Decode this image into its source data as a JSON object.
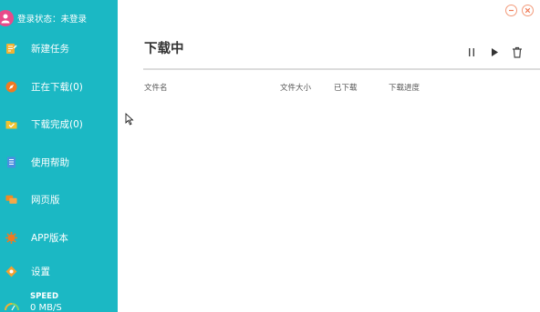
{
  "sidebar": {
    "login_status": "登录状态：未登录",
    "items": [
      {
        "label": "新建任务",
        "icon": "new-task-icon",
        "color": "#f2b233"
      },
      {
        "label": "正在下载(0)",
        "icon": "compass-icon",
        "color": "#f07a22"
      },
      {
        "label": "下载完成(0)",
        "icon": "folder-check-icon",
        "color": "#f2c230"
      },
      {
        "label": "使用帮助",
        "icon": "help-book-icon",
        "color": "#4a8fe0"
      },
      {
        "label": "网页版",
        "icon": "chat-bubbles-icon",
        "color": "#f08a22"
      },
      {
        "label": "APP版本",
        "icon": "gear-sun-icon",
        "color": "#f07a22"
      },
      {
        "label": "设置",
        "icon": "settings-icon",
        "color": "#f2a030"
      }
    ],
    "speed_title": "SPEED",
    "speed_value": "0 MB/S"
  },
  "main": {
    "title": "下载中",
    "columns": [
      "文件名",
      "文件大小",
      "已下载",
      "下载进度"
    ]
  },
  "colors": {
    "sidebar_bg": "#1bb8c4",
    "avatar": "#e84a8a",
    "window_button": "#f29a7a"
  }
}
